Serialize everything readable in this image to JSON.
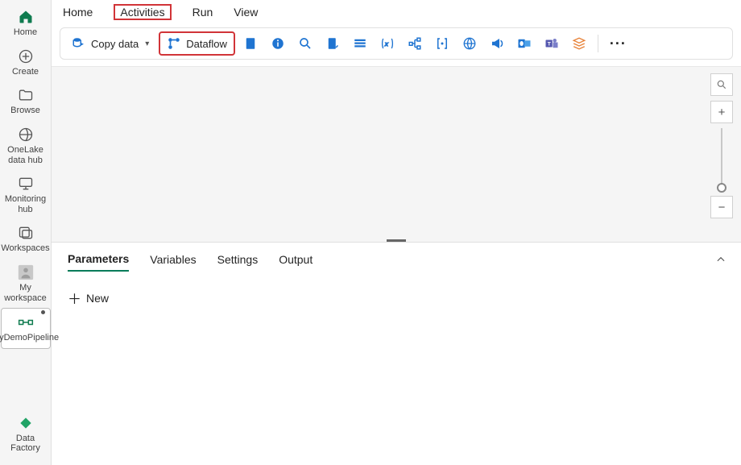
{
  "sidebar": {
    "items": [
      {
        "label": "Home",
        "icon": "home-icon"
      },
      {
        "label": "Create",
        "icon": "plus-circle-icon"
      },
      {
        "label": "Browse",
        "icon": "folder-icon"
      },
      {
        "label": "OneLake data hub",
        "icon": "onelake-icon"
      },
      {
        "label": "Monitoring hub",
        "icon": "monitor-icon"
      },
      {
        "label": "Workspaces",
        "icon": "workspaces-icon"
      },
      {
        "label": "My workspace",
        "icon": "avatar-icon"
      },
      {
        "label": "MyDemoPipeline",
        "icon": "pipeline-icon",
        "selected": true,
        "unsaved": true
      }
    ],
    "bottom": {
      "label": "Data Factory",
      "icon": "data-factory-icon"
    }
  },
  "topTabs": {
    "items": [
      "Home",
      "Activities",
      "Run",
      "View"
    ],
    "highlighted": "Activities"
  },
  "toolbar": {
    "copyData": {
      "label": "Copy data",
      "icon": "copy-data-icon"
    },
    "dataflow": {
      "label": "Dataflow",
      "icon": "dataflow-icon",
      "highlighted": true
    },
    "icons": [
      {
        "name": "notebook-icon",
        "color": "#1f74d1"
      },
      {
        "name": "info-icon",
        "color": "#1f74d1"
      },
      {
        "name": "search-blue-icon",
        "color": "#1f74d1"
      },
      {
        "name": "script-icon",
        "color": "#1f74d1"
      },
      {
        "name": "list-icon",
        "color": "#1f74d1"
      },
      {
        "name": "variable-icon",
        "color": "#1f74d1"
      },
      {
        "name": "branch-icon",
        "color": "#1f74d1"
      },
      {
        "name": "bracket-icon",
        "color": "#1f74d1"
      },
      {
        "name": "globe-icon",
        "color": "#1f74d1"
      },
      {
        "name": "bullhorn-icon",
        "color": "#1f74d1"
      },
      {
        "name": "outlook-icon",
        "color": "#1f74d1"
      },
      {
        "name": "teams-icon",
        "color": "#5558af"
      },
      {
        "name": "layers-icon",
        "color": "#e8833a"
      }
    ],
    "more": "···"
  },
  "canvasControls": {
    "search": "search-icon",
    "zoomIn": "+",
    "zoomOut": "−"
  },
  "bottomPanel": {
    "tabs": [
      "Parameters",
      "Variables",
      "Settings",
      "Output"
    ],
    "active": "Parameters",
    "newLabel": "New"
  }
}
